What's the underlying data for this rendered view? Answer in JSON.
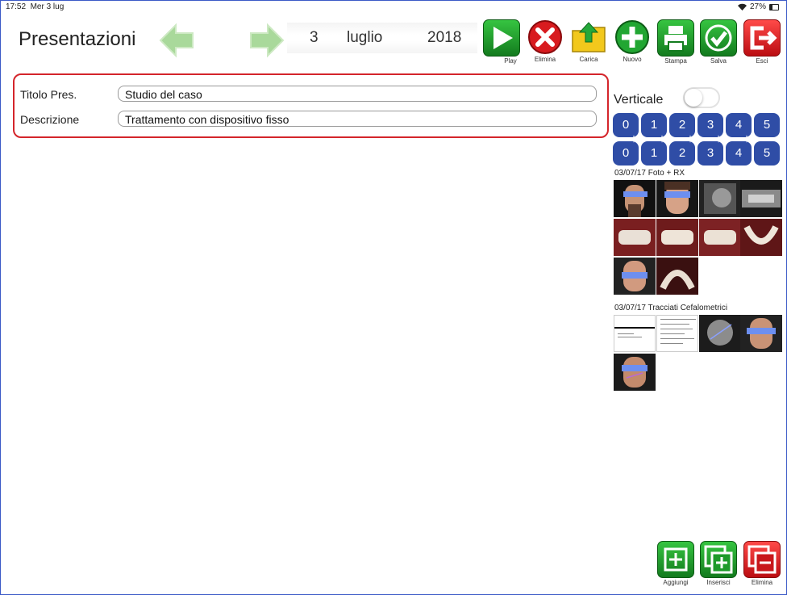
{
  "status": {
    "time": "17:52",
    "date": "Mer 3 lug",
    "battery": "27%"
  },
  "header": {
    "title": "Presentazioni",
    "date": {
      "day": "3",
      "month": "luglio",
      "year": "2018"
    }
  },
  "toolbar": {
    "play": "Play",
    "delete": "Elimina",
    "load": "Carica",
    "new": "Nuovo",
    "print": "Stampa",
    "save": "Salva",
    "exit": "Esci"
  },
  "form": {
    "title_label": "Titolo Pres.",
    "title_value": "Studio del caso",
    "desc_label": "Descrizione",
    "desc_value": "Trattamento con dispositivo fisso"
  },
  "side": {
    "vertical_label": "Verticale",
    "vertical_on": false,
    "rating_top": [
      "0",
      "1",
      "2",
      "3",
      "4",
      "5"
    ],
    "rating_bottom": [
      "0",
      "1",
      "2",
      "3",
      "4",
      "5"
    ],
    "groups": [
      {
        "label": "03/07/17 Foto + RX",
        "count": 10
      },
      {
        "label": "03/07/17 Tracciati Cefalometrici",
        "count": 5
      }
    ]
  },
  "bottom": {
    "add": "Aggiungi",
    "insert": "Inserisci",
    "delete": "Elimina"
  },
  "colors": {
    "accent_red": "#d4252b",
    "green": "#1e9a2a",
    "blue_pill": "#2f4da6",
    "frame": "#3b59c7"
  }
}
